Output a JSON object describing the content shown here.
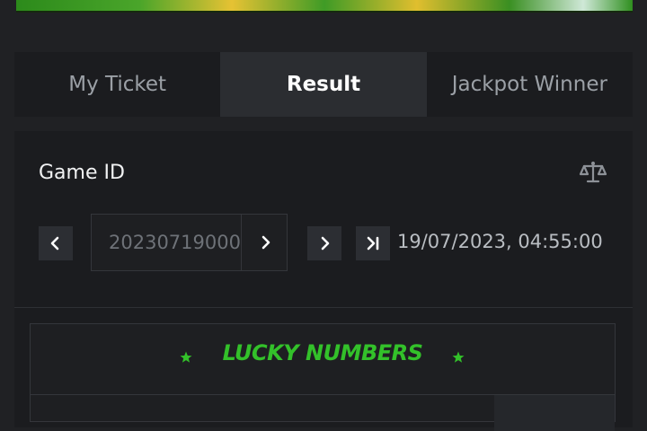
{
  "tabs": [
    {
      "label": "My Ticket",
      "active": false
    },
    {
      "label": "Result",
      "active": true
    },
    {
      "label": "Jackpot Winner",
      "active": false
    }
  ],
  "game": {
    "label": "Game ID",
    "id_value": "20230719000",
    "datetime": "19/07/2023, 04:55:00"
  },
  "icons": {
    "scale": "balance-scale-icon",
    "prev": "chevron-left-icon",
    "next": "chevron-right-icon",
    "last": "skip-to-last-icon",
    "star": "star-icon"
  },
  "lucky": {
    "title": "LUCKY NUMBERS"
  },
  "colors": {
    "background": "#202124",
    "panel": "#1b1c1f",
    "active_tab": "#2b2d31",
    "accent_green": "#33c12a"
  }
}
